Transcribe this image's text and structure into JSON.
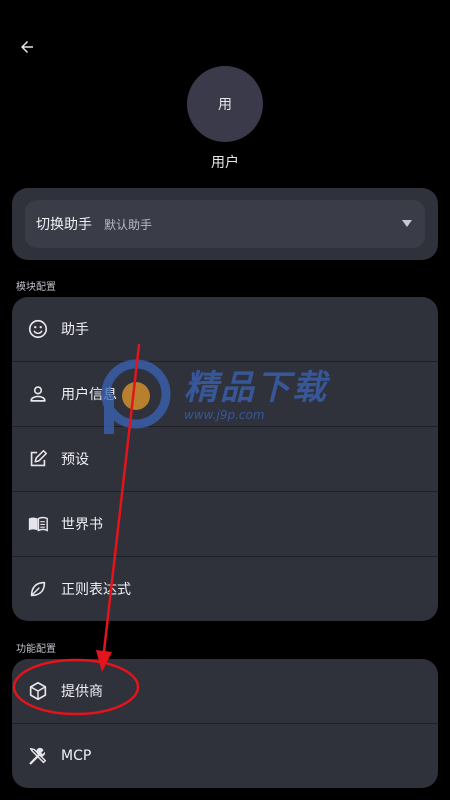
{
  "header": {
    "back_icon": "arrow-left-icon"
  },
  "user": {
    "avatar_text": "用",
    "name": "用户"
  },
  "switcher": {
    "label": "切换助手",
    "value": "默认助手",
    "arrow_icon": "triangle-down-icon"
  },
  "sections": {
    "module": {
      "label": "模块配置",
      "items": [
        {
          "label": "助手",
          "icon": "smiley-icon"
        },
        {
          "label": "用户信息",
          "icon": "person-icon"
        },
        {
          "label": "预设",
          "icon": "edit-square-icon"
        },
        {
          "label": "世界书",
          "icon": "book-icon"
        },
        {
          "label": "正则表达式",
          "icon": "leaf-icon"
        }
      ]
    },
    "feature": {
      "label": "功能配置",
      "items": [
        {
          "label": "提供商",
          "icon": "cube-icon"
        },
        {
          "label": "MCP",
          "icon": "tools-icon"
        }
      ]
    }
  },
  "watermark": {
    "title": "精品下载",
    "url": "www.j9p.com"
  },
  "colors": {
    "background": "#000000",
    "card": "#2f313b",
    "annotation": "#e3141b"
  }
}
